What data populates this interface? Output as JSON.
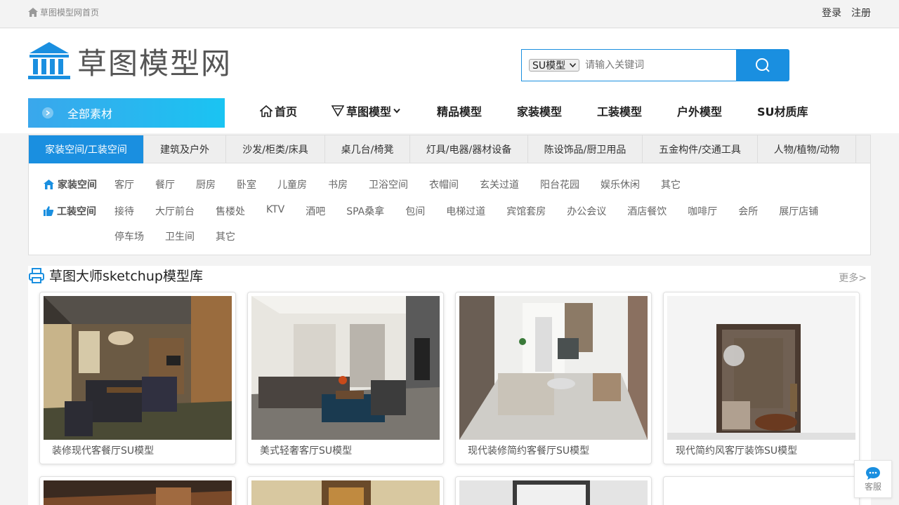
{
  "topbar": {
    "home_text": "草图模型网首页",
    "login": "登录",
    "register": "注册"
  },
  "logo": {
    "text": "草图模型网"
  },
  "search": {
    "select_value": "SU模型",
    "placeholder": "请输入关键词"
  },
  "all_button": {
    "label": "全部素材"
  },
  "nav": {
    "home": "首页",
    "caotu": "草图模型",
    "jingpin": "精品模型",
    "jiazhuang": "家装模型",
    "gongzhuang": "工装模型",
    "huwai": "户外模型",
    "su_material": "SU材质库"
  },
  "category_tabs": [
    "家装空间/工装空间",
    "建筑及户外",
    "沙发/柜类/床具",
    "桌几台/椅凳",
    "灯具/电器/器材设备",
    "陈设饰品/厨卫用品",
    "五金构件/交通工具",
    "人物/植物/动物"
  ],
  "jiazhuang_row": {
    "label": "家装空间",
    "items": [
      "客厅",
      "餐厅",
      "厨房",
      "卧室",
      "儿童房",
      "书房",
      "卫浴空间",
      "衣帽间",
      "玄关过道",
      "阳台花园",
      "娱乐休闲",
      "其它"
    ]
  },
  "gongzhuang_row": {
    "label": "工装空间",
    "items": [
      "接待",
      "大厅前台",
      "售楼处",
      "KTV",
      "酒吧",
      "SPA桑拿",
      "包间",
      "电梯过道",
      "宾馆套房",
      "办公会议",
      "酒店餐饮",
      "咖啡厅",
      "会所",
      "展厅店铺",
      "停车场",
      "卫生间",
      "其它"
    ]
  },
  "section": {
    "title": "草图大师sketchup模型库",
    "more": "更多>"
  },
  "cards": [
    {
      "caption": "装修现代客餐厅SU模型"
    },
    {
      "caption": "美式轻奢客厅SU模型"
    },
    {
      "caption": "现代装修简约客餐厅SU模型"
    },
    {
      "caption": "现代简约风客厅装饰SU模型"
    }
  ],
  "kefu": {
    "label": "客服"
  },
  "colors": {
    "accent": "#1a8fe0",
    "gradient_end": "#1ac4f2"
  }
}
